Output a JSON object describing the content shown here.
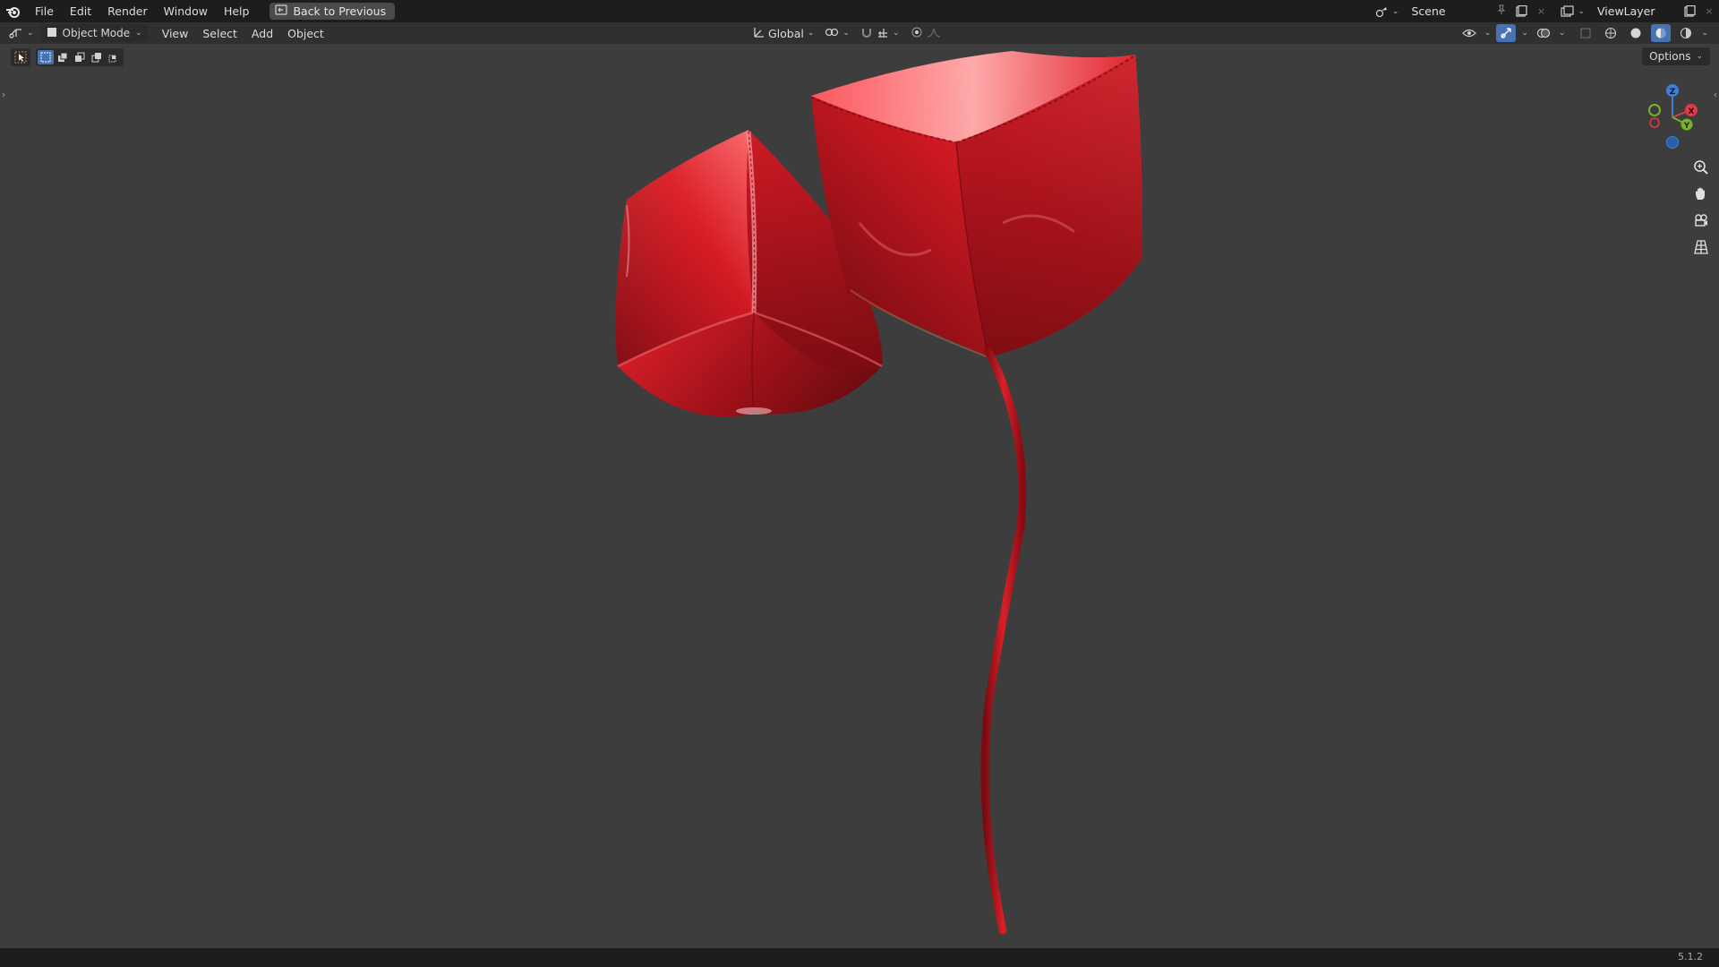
{
  "menu": {
    "items": [
      "File",
      "Edit",
      "Render",
      "Window",
      "Help"
    ],
    "back_label": "Back to Previous"
  },
  "topright": {
    "scene_name": "Scene",
    "viewlayer_name": "ViewLayer"
  },
  "header": {
    "mode_label": "Object Mode",
    "view_label": "View",
    "select_label": "Select",
    "add_label": "Add",
    "object_label": "Object",
    "orientation_label": "Global"
  },
  "viewport": {
    "options_label": "Options",
    "gizmo": {
      "z": "Z",
      "x": "X",
      "y": "Y"
    }
  },
  "status": {
    "version": "5.1.2"
  },
  "colors": {
    "balloon_red": "#e0202a",
    "active_blue": "#4772b3"
  }
}
